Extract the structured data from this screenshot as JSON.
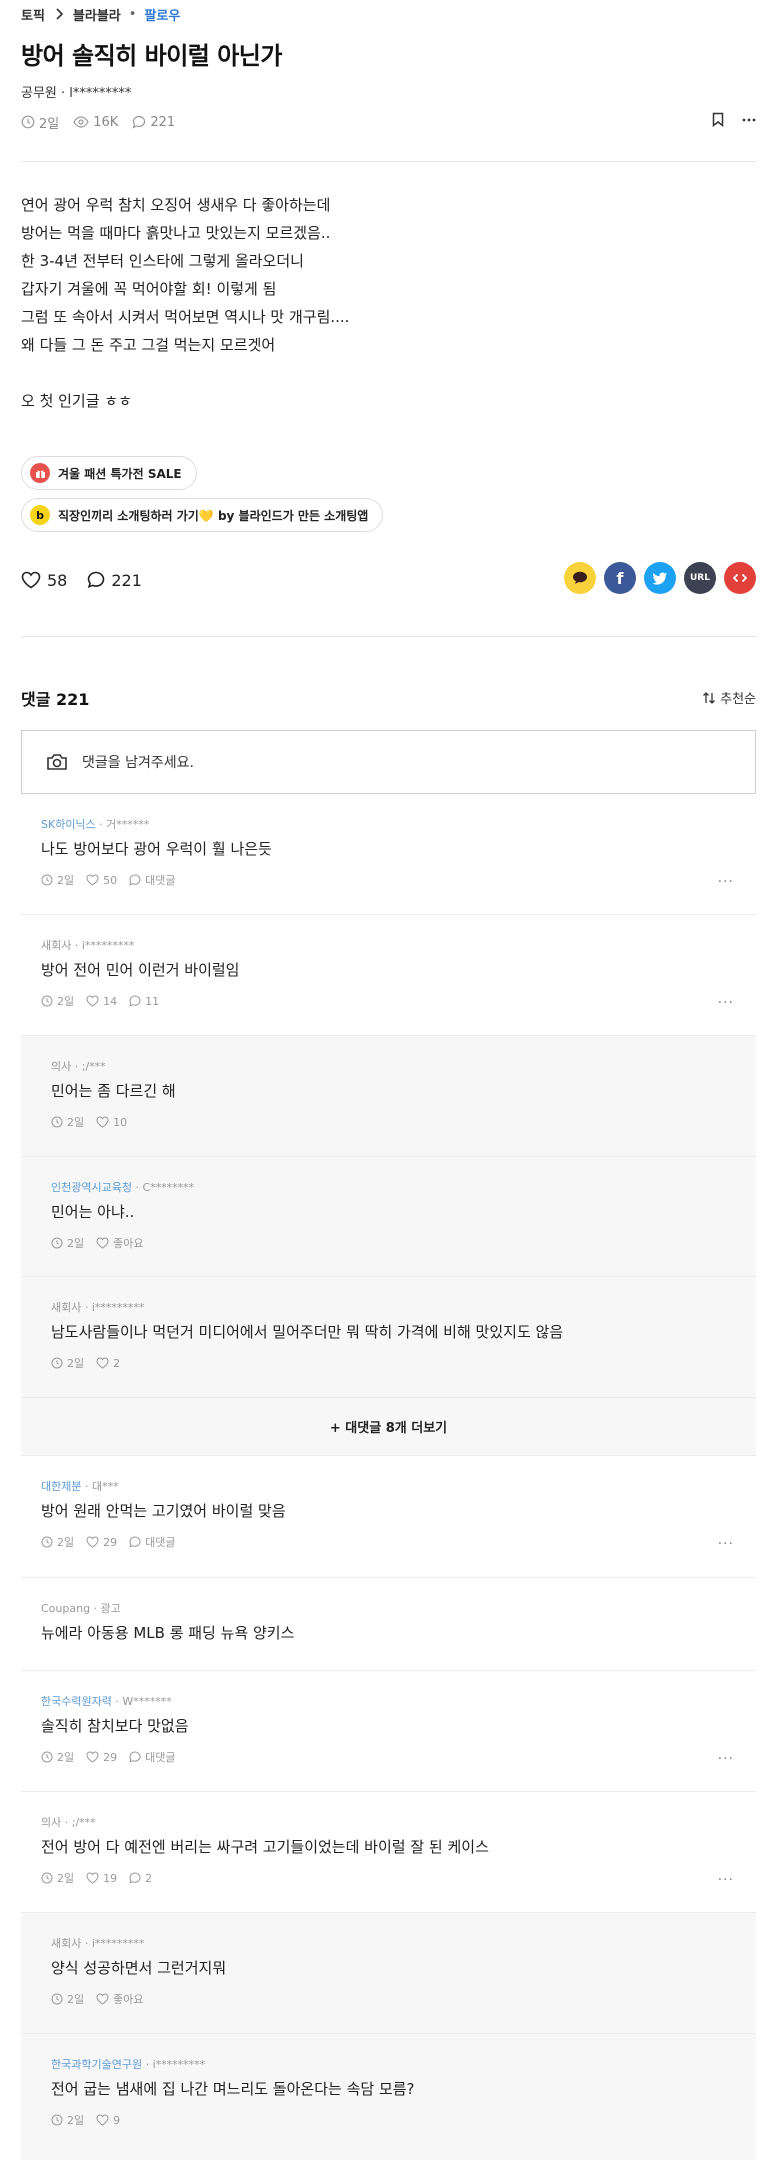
{
  "breadcrumb": {
    "topic": "토픽",
    "channel": "블라블라",
    "follow": "팔로우"
  },
  "post": {
    "title": "방어 솔직히 바이럴 아닌가",
    "author": "공무원 · l*********",
    "time": "2일",
    "views": "16K",
    "comments": "221",
    "body": [
      "연어 광어 우럭 참치 오징어 생새우 다 좋아하는데",
      "방어는 먹을 때마다 흙맛나고 맛있는지 모르겠음..",
      "한 3-4년 전부터 인스타에 그렇게 올라오더니",
      "갑자기 겨울에 꼭 먹어야할 회! 이렇게 됨",
      "그럼 또 속아서 시켜서 먹어보면 역시나 맛 개구림....",
      "왜 다들 그 돈 주고 그걸 먹는지 모르겟어",
      "",
      "오 첫 인기글 ㅎㅎ"
    ],
    "likes": "58",
    "comment_count": "221"
  },
  "promos": [
    {
      "label": "겨울 패션 특가전 SALE",
      "icon": "gift-icon",
      "color": "#e8524d"
    },
    {
      "label": "직장인끼리 소개팅하러 가기💛 by 블라인드가 만든 소개팅앱",
      "icon": "b-logo-icon",
      "color": "#f5d31a"
    }
  ],
  "share": {
    "url_label": "URL",
    "colors": {
      "kakao": "#f7d23a",
      "facebook": "#3b5998",
      "twitter": "#1da1f2",
      "url": "#3c4252",
      "embed": "#e4403b"
    }
  },
  "comments_section": {
    "title": "댓글 221",
    "sort_label": "추천순",
    "input_placeholder": "댓글을 남겨주세요."
  },
  "comments": [
    {
      "company": "SK하이닉스",
      "user": " · 거******",
      "text": "나도 방어보다 광어 우럭이 훨 나은듯",
      "time": "2일",
      "likes": "50",
      "replies": "대댓글",
      "reply": false
    },
    {
      "company": "새회사",
      "user": " · i*********",
      "text": "방어 전어 민어 이런거 바이럴임",
      "time": "2일",
      "likes": "14",
      "replies": "11",
      "reply": false
    },
    {
      "company": "의사",
      "user": " · ;/***",
      "text": "민어는 좀 다르긴 해",
      "time": "2일",
      "likes": "10",
      "replies": "",
      "reply": true
    },
    {
      "company": "인천광역시교육청",
      "user": " · C********",
      "text": "민어는 아냐..",
      "time": "2일",
      "likes": "좋아요",
      "replies": "",
      "reply": true
    },
    {
      "company": "새회사",
      "user": " · i*********",
      "text": "남도사람들이나 먹던거 미디어에서 밀어주더만 뭐 딱히 가격에 비해 맛있지도 않음",
      "time": "2일",
      "likes": "2",
      "replies": "",
      "reply": true
    }
  ],
  "more_replies": "+ 대댓글 8개 더보기",
  "comments2": [
    {
      "company": "대한제분",
      "user": " · 대***",
      "text": "방어 원래 안먹는 고기였어 바이럴 맞음",
      "time": "2일",
      "likes": "29",
      "replies": "대댓글",
      "reply": false
    },
    {
      "company": "한국수력원자력",
      "user": " · W*******",
      "text": "솔직히 참치보다 맛없음",
      "time": "2일",
      "likes": "29",
      "replies": "대댓글",
      "reply": false
    },
    {
      "company": "의사",
      "user": " · ;/***",
      "text": "전어 방어 다 예전엔 버리는 싸구려 고기들이었는데 바이럴 잘 된 케이스",
      "time": "2일",
      "likes": "19",
      "replies": "2",
      "reply": false
    },
    {
      "company": "새회사",
      "user": " · i*********",
      "text": "양식 성공하면서 그런거지뭐",
      "time": "2일",
      "likes": "좋아요",
      "replies": "",
      "reply": true
    },
    {
      "company": "한국과학기술연구원",
      "user": " · i*********",
      "text": "전어 굽는 냄새에 집 나간 며느리도 돌아온다는 속담 모름?",
      "time": "2일",
      "likes": "9",
      "replies": "",
      "reply": true
    }
  ],
  "ad": {
    "source": "Coupang · 광고",
    "text": "뉴에라 아동용 MLB 롱 패딩 뉴욕 양키스"
  }
}
